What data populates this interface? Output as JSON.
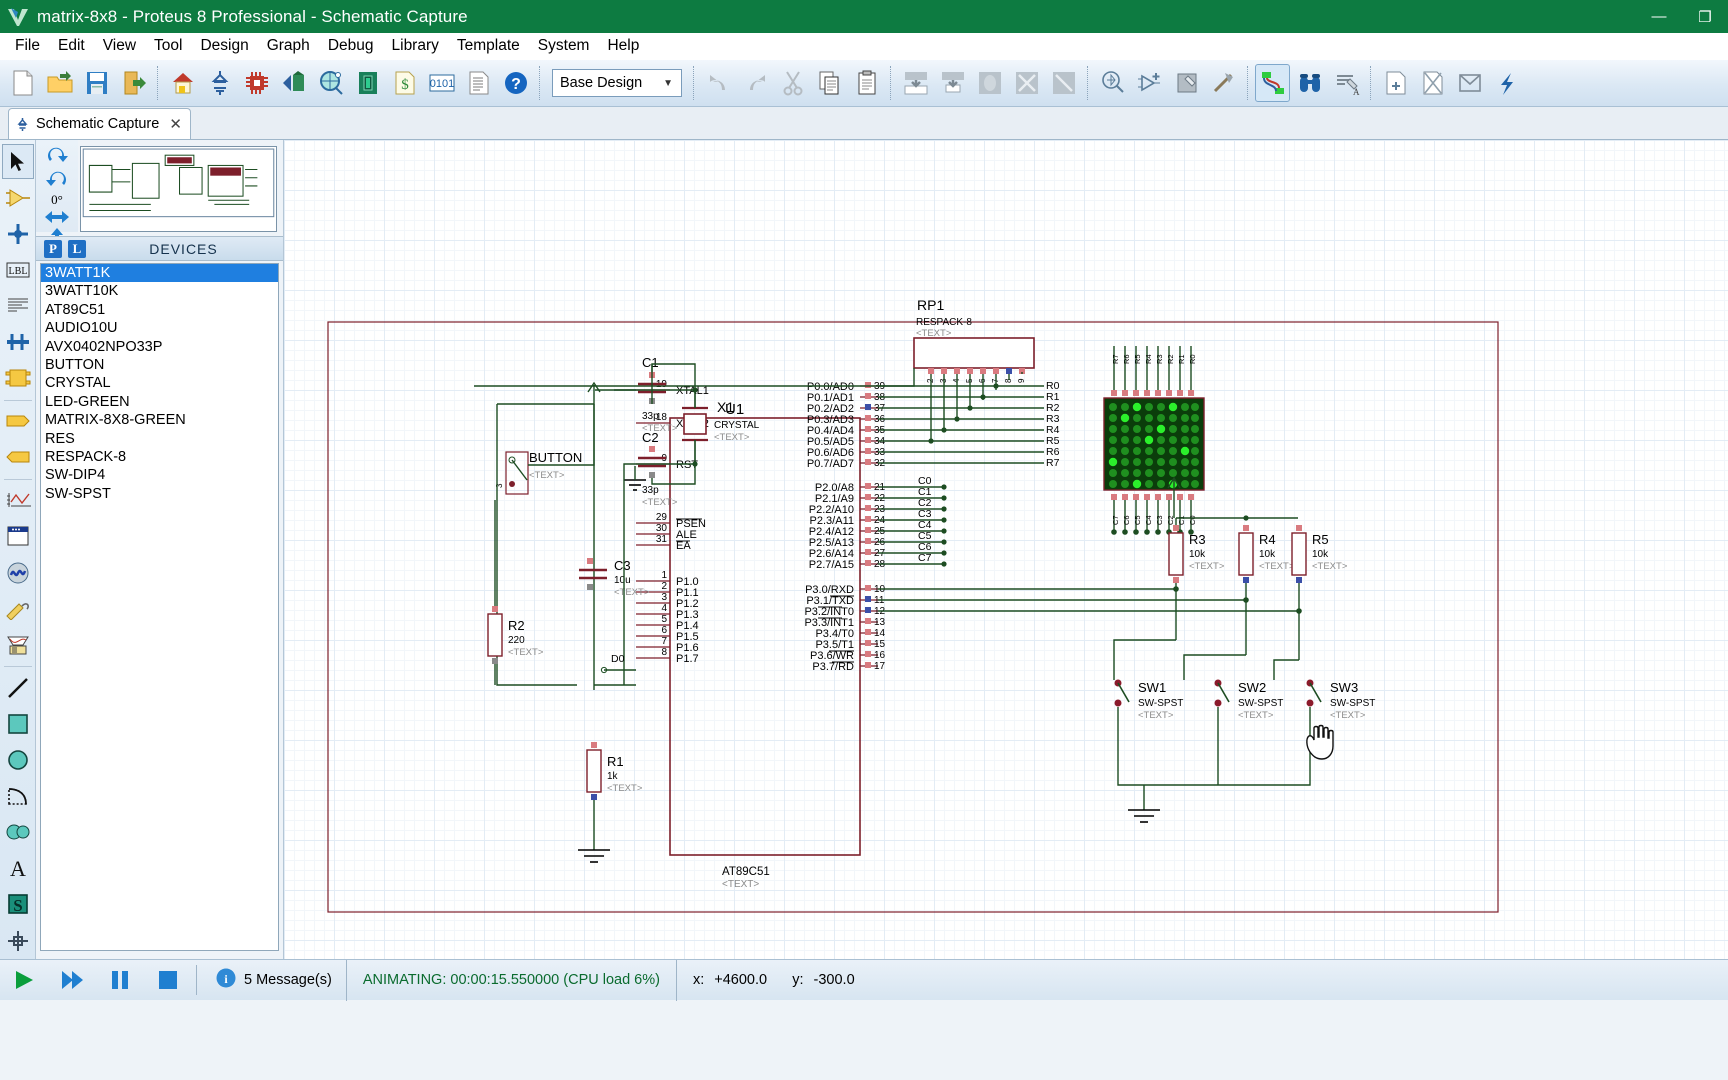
{
  "window": {
    "title": "matrix-8x8 - Proteus 8 Professional - Schematic Capture",
    "minimize": "—",
    "maximize": "❐",
    "close": "✕"
  },
  "menubar": {
    "items": [
      "File",
      "Edit",
      "View",
      "Tool",
      "Design",
      "Graph",
      "Debug",
      "Library",
      "Template",
      "System",
      "Help"
    ]
  },
  "toolbar": {
    "design_selector": "Base Design",
    "buttons": [
      "new-file-icon",
      "open-folder-icon",
      "save-icon",
      "export-icon",
      "home-icon",
      "schematic-icon",
      "pcb-icon",
      "3d-view-icon",
      "gerber-view-icon",
      "design-explorer-icon",
      "bill-of-materials-icon",
      "digital-icon",
      "report-icon",
      "help-icon"
    ],
    "edit_buttons": [
      "undo-icon",
      "redo-icon",
      "cut-icon",
      "copy-icon",
      "paste-icon"
    ],
    "block_buttons": [
      "block-copy-icon",
      "block-move-icon",
      "block-rotate-icon",
      "block-delete-icon"
    ],
    "tool_buttons": [
      "pick-device-icon",
      "make-device-icon",
      "packaging-tool-icon",
      "decompose-icon"
    ],
    "net_buttons": [
      "wire-autorouter-icon",
      "search-tag-icon",
      "property-assign-icon"
    ],
    "sheet_buttons": [
      "new-sheet-icon",
      "remove-sheet-icon",
      "goto-sheet-icon",
      "exit-subsheet-icon"
    ]
  },
  "tab": {
    "label": "Schematic Capture",
    "icon": "schematic-tab-icon",
    "close": "✕"
  },
  "left_toolbar": {
    "tools": [
      {
        "name": "selection-mode-tool",
        "selected": true
      },
      {
        "name": "component-mode-tool",
        "selected": false
      },
      {
        "name": "junction-dot-tool",
        "selected": false
      },
      {
        "name": "wire-label-tool",
        "selected": false
      },
      {
        "name": "text-script-tool",
        "selected": false
      },
      {
        "name": "buses-tool",
        "selected": false
      },
      {
        "name": "subcircuit-tool",
        "selected": false
      },
      {
        "name": "terminals-tool",
        "selected": false
      },
      {
        "name": "device-pins-tool",
        "selected": false
      },
      {
        "name": "graph-mode-tool",
        "selected": false
      },
      {
        "name": "tape-recorder-tool",
        "selected": false
      },
      {
        "name": "generator-mode-tool",
        "selected": false
      },
      {
        "name": "voltage-probe-tool",
        "selected": false
      },
      {
        "name": "virtual-instruments-tool",
        "selected": false
      },
      {
        "name": "line-tool",
        "selected": false
      },
      {
        "name": "box-tool",
        "selected": false
      },
      {
        "name": "circle-tool",
        "selected": false
      },
      {
        "name": "arc-tool",
        "selected": false
      },
      {
        "name": "path-tool",
        "selected": false
      },
      {
        "name": "text-tool",
        "selected": false
      },
      {
        "name": "symbol-tool",
        "selected": false
      },
      {
        "name": "marker-tool",
        "selected": false
      }
    ]
  },
  "rotation": {
    "clockwise": "rotate-clockwise-icon",
    "counterclockwise": "rotate-counterclockwise-icon",
    "angle": "0°",
    "mirror_x": "mirror-horizontal-icon",
    "mirror_y": "mirror-vertical-icon"
  },
  "devices_panel": {
    "p_badge": "P",
    "l_badge": "L",
    "title": "DEVICES",
    "items": [
      "3WATT1K",
      "3WATT10K",
      "AT89C51",
      "AUDIO10U",
      "AVX0402NPO33P",
      "BUTTON",
      "CRYSTAL",
      "LED-GREEN",
      "MATRIX-8X8-GREEN",
      "RES",
      "RESPACK-8",
      "SW-DIP4",
      "SW-SPST"
    ],
    "selected_index": 0
  },
  "statusbar": {
    "play": "play-icon",
    "step": "step-icon",
    "pause": "pause-icon",
    "stop": "stop-icon",
    "info_icon": "info-icon",
    "messages": "5 Message(s)",
    "animating": "ANIMATING: 00:00:15.550000 (CPU load 6%)",
    "x_label": "x:",
    "x_value": "+4600.0",
    "y_label": "y:",
    "y_value": "-300.0"
  },
  "schematic": {
    "components": [
      {
        "ref": "U1",
        "value": "AT89C51",
        "text": "<TEXT>"
      },
      {
        "ref": "X1",
        "value": "CRYSTAL",
        "text": "<TEXT>"
      },
      {
        "ref": "C1",
        "value": "33p",
        "text": "<TEXT>"
      },
      {
        "ref": "C2",
        "value": "33p",
        "text": "<TEXT>"
      },
      {
        "ref": "C3",
        "value": "10u",
        "text": "<TEXT>"
      },
      {
        "ref": "R1",
        "value": "1k",
        "text": "<TEXT>"
      },
      {
        "ref": "R2",
        "value": "220",
        "text": "<TEXT>"
      },
      {
        "ref": "R3",
        "value": "10k",
        "text": "<TEXT>"
      },
      {
        "ref": "R4",
        "value": "10k",
        "text": "<TEXT>"
      },
      {
        "ref": "R5",
        "value": "10k",
        "text": "<TEXT>"
      },
      {
        "ref": "RP1",
        "value": "RESPACK-8",
        "text": "<TEXT>"
      },
      {
        "ref": "SW1",
        "value": "SW-SPST",
        "text": "<TEXT>"
      },
      {
        "ref": "SW2",
        "value": "SW-SPST",
        "text": "<TEXT>"
      },
      {
        "ref": "SW3",
        "value": "SW-SPST",
        "text": "<TEXT>"
      },
      {
        "ref": "BUTTON",
        "value": "",
        "text": "<TEXT>"
      }
    ],
    "u1": {
      "ref": "U1",
      "part": "AT89C51",
      "text": "<TEXT>",
      "left_pins": [
        {
          "num": "19",
          "label": "XTAL1"
        },
        {
          "num": "18",
          "label": "XTAL2"
        },
        {
          "num": "9",
          "label": "RST"
        },
        {
          "num": "29",
          "label": "PSEN",
          "bar": true
        },
        {
          "num": "30",
          "label": "ALE"
        },
        {
          "num": "31",
          "label": "EA",
          "bar": true
        },
        {
          "num": "1",
          "label": "P1.0"
        },
        {
          "num": "2",
          "label": "P1.1"
        },
        {
          "num": "3",
          "label": "P1.2"
        },
        {
          "num": "4",
          "label": "P1.3"
        },
        {
          "num": "5",
          "label": "P1.4"
        },
        {
          "num": "6",
          "label": "P1.5"
        },
        {
          "num": "7",
          "label": "P1.6"
        },
        {
          "num": "8",
          "label": "P1.7"
        }
      ],
      "right_pins_p0": [
        {
          "num": "39",
          "label": "P0.0/AD0"
        },
        {
          "num": "38",
          "label": "P0.1/AD1"
        },
        {
          "num": "37",
          "label": "P0.2/AD2"
        },
        {
          "num": "36",
          "label": "P0.3/AD3"
        },
        {
          "num": "35",
          "label": "P0.4/AD4"
        },
        {
          "num": "34",
          "label": "P0.5/AD5"
        },
        {
          "num": "33",
          "label": "P0.6/AD6"
        },
        {
          "num": "32",
          "label": "P0.7/AD7"
        }
      ],
      "right_pins_p2": [
        {
          "num": "21",
          "label": "P2.0/A8"
        },
        {
          "num": "22",
          "label": "P2.1/A9"
        },
        {
          "num": "23",
          "label": "P2.2/A10"
        },
        {
          "num": "24",
          "label": "P2.3/A11"
        },
        {
          "num": "25",
          "label": "P2.4/A12"
        },
        {
          "num": "26",
          "label": "P2.5/A13"
        },
        {
          "num": "27",
          "label": "P2.6/A14"
        },
        {
          "num": "28",
          "label": "P2.7/A15"
        }
      ],
      "right_pins_p3": [
        {
          "num": "10",
          "label": "P3.0/RXD"
        },
        {
          "num": "11",
          "label": "P3.1/TXD"
        },
        {
          "num": "12",
          "label": "P3.2/INT0"
        },
        {
          "num": "13",
          "label": "P3.3/INT1"
        },
        {
          "num": "14",
          "label": "P3.4/T0"
        },
        {
          "num": "15",
          "label": "P3.5/T1"
        },
        {
          "num": "16",
          "label": "P3.6/WR"
        },
        {
          "num": "17",
          "label": "P3.7/RD"
        }
      ]
    },
    "net_labels_rows": [
      "R0",
      "R1",
      "R2",
      "R3",
      "R4",
      "R5",
      "R6",
      "R7"
    ],
    "net_labels_cols": [
      "C0",
      "C1",
      "C2",
      "C3",
      "C4",
      "C5",
      "C6",
      "C7"
    ],
    "matrix_row_pins": [
      "R7",
      "R6",
      "R5",
      "R4",
      "R3",
      "R2",
      "R1",
      "R0"
    ],
    "matrix_col_pins": [
      "C7",
      "C6",
      "C5",
      "C4",
      "C3",
      "C2",
      "C1",
      "C0"
    ],
    "respack_pins": [
      "1",
      "2",
      "3",
      "4",
      "5",
      "6",
      "7",
      "8",
      "9"
    ],
    "d0_label": "D0",
    "colors": {
      "wire": "#1d4d22",
      "body": "#7d1f2b",
      "pin_red": "#d97b80",
      "pin_blue": "#3b4fa8",
      "led_on": "#1ddb1d",
      "led_off": "#1f7a1f",
      "text": "#000000",
      "grey_text": "#8a8a8a"
    }
  }
}
